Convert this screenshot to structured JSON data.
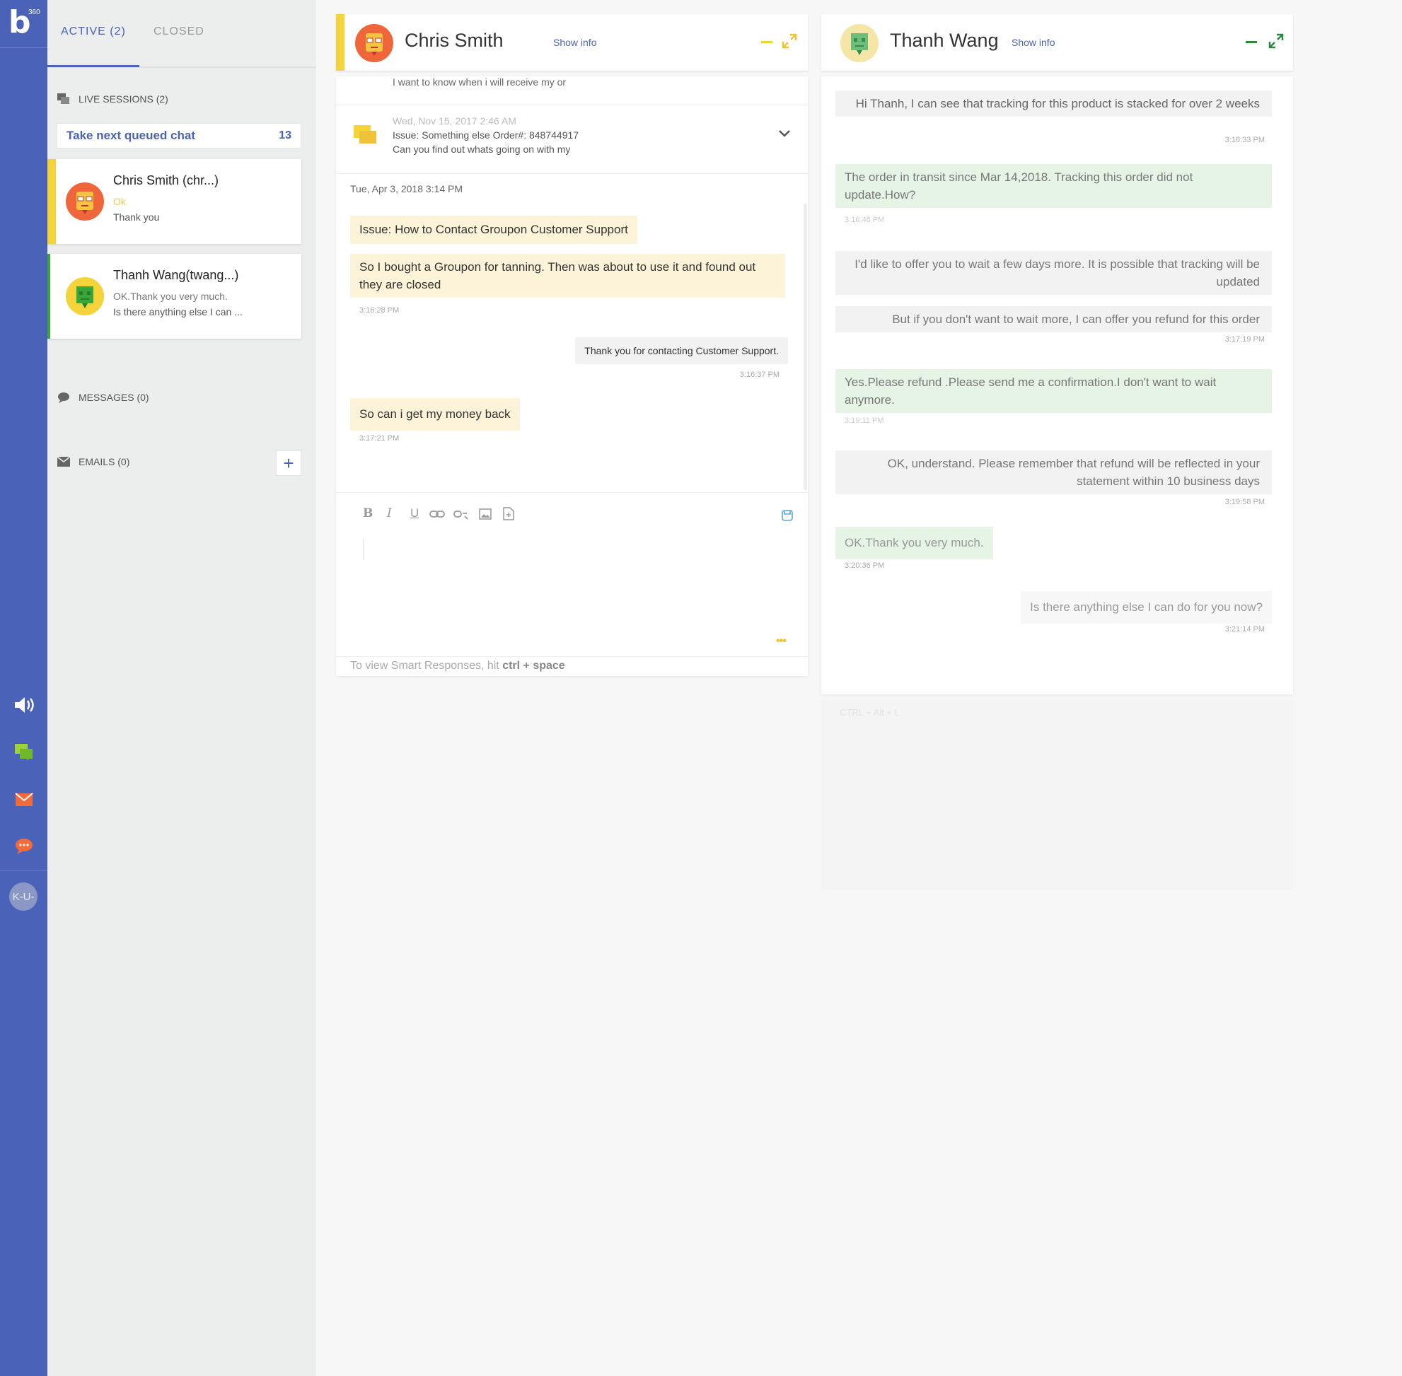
{
  "app": {
    "logo_letter": "b",
    "logo_sup": "360"
  },
  "rail": {
    "user_initials": "K-U-"
  },
  "tabs": {
    "active": "ACTIVE (2)",
    "closed": "CLOSED"
  },
  "sidebar": {
    "live_sessions": "LIVE SESSIONS (2)",
    "queue_label": "Take next queued chat",
    "queue_count": "13",
    "messages": "MESSAGES (0)",
    "emails": "EMAILS (0)",
    "add": "+",
    "sessions": [
      {
        "name": "Chris Smith (chr...)",
        "line1": "Ok",
        "line2": "Thank you",
        "accent": "#f5d43b"
      },
      {
        "name": "Thanh Wang(twang...)",
        "line1": "OK.Thank you very much.",
        "line2": "Is there anything else I can ...",
        "accent": "#3aa53a"
      }
    ]
  },
  "chat1": {
    "title": "Chris Smith",
    "show_info": "Show info",
    "truncated_top": "I want to know when i will receive my or",
    "history": {
      "date": "Wed, Nov 15, 2017 2:46 AM",
      "line1": "Issue: Something else Order#: 848744917",
      "line2": "Can you find out whats going on with my"
    },
    "date_divider": "Tue, Apr 3, 2018 3:14 PM",
    "messages": [
      {
        "text": "Issue: How to Contact Groupon Customer Support",
        "time": ""
      },
      {
        "text": "So I bought a Groupon for tanning. Then was about to use it and found out they are closed",
        "time": "3:16:28 PM"
      },
      {
        "text": "Thank you for contacting Customer Support.",
        "time": "3:16:37 PM"
      },
      {
        "text": "So can i get my money back",
        "time": "3:17:21 PM"
      }
    ],
    "toolbar": {
      "bold": "B",
      "italic": "I",
      "underline": "U"
    },
    "more": "•••",
    "hint_prefix": "To view Smart Responses, hit ",
    "hint_keys": "ctrl + space"
  },
  "chat2": {
    "title": "Thanh Wang",
    "show_info": "Show info",
    "messages": [
      {
        "text": "Hi Thanh, I can see that tracking for this product is stacked for over 2 weeks",
        "time": "3:16:33 PM"
      },
      {
        "text": "The order in transit since Mar 14,2018. Tracking this order did not update.How?",
        "time": "3:16:46 PM"
      },
      {
        "text": "I'd like to offer you to wait a few days more. It is possible that tracking will be updated",
        "time": ""
      },
      {
        "text": "But if you don't want to wait more, I can offer you refund for this order",
        "time": "3:17:19 PM"
      },
      {
        "text": "Yes.Please refund .Please send me a confirmation.I don't want to wait anymore.",
        "time": "3:19:11 PM"
      },
      {
        "text": "OK, understand. Please remember that refund will be reflected in your statement within 10 business days",
        "time": "3:19:58 PM"
      },
      {
        "text": "OK.Thank you very much.",
        "time": "3:20:36 PM"
      },
      {
        "text": "Is there anything else I can do for you now?",
        "time": "3:21:14 PM"
      }
    ],
    "shortcut": "CTRL + Alt + L"
  },
  "colors": {
    "brand": "#4a62b8",
    "customer_bubble": "#fdf3d8",
    "customer_bubble_green": "#e6f4e6",
    "agent_bubble": "#f2f2f2",
    "accent_yellow": "#f5d43b",
    "accent_green": "#3aa53a"
  },
  "icons": [
    "volume-icon",
    "chat-bubbles-icon",
    "mail-icon",
    "sms-icon",
    "bold-icon",
    "italic-icon",
    "underline-icon",
    "link-icon",
    "unlink-icon",
    "image-icon",
    "file-icon",
    "save-icon",
    "minimize-icon",
    "expand-icon",
    "chevron-down-icon"
  ]
}
